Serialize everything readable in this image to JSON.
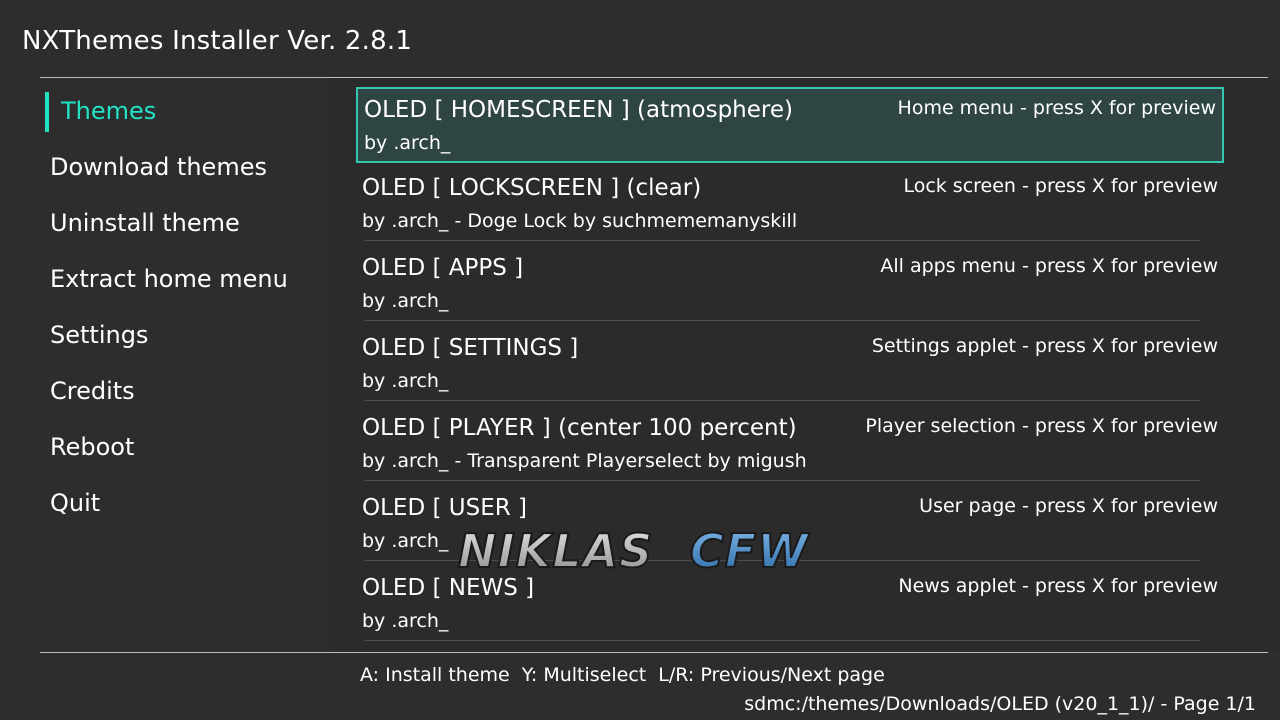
{
  "app": {
    "title": "NXThemes Installer Ver. 2.8.1"
  },
  "colors": {
    "accent": "#22e3c4",
    "background": "#2d2d2d",
    "selected_row": "#2f4543"
  },
  "sidebar": {
    "items": [
      {
        "label": "Themes",
        "active": true
      },
      {
        "label": "Download themes"
      },
      {
        "label": "Uninstall theme"
      },
      {
        "label": "Extract home menu"
      },
      {
        "label": "Settings"
      },
      {
        "label": "Credits"
      },
      {
        "label": "Reboot"
      },
      {
        "label": "Quit"
      }
    ]
  },
  "themes": [
    {
      "name": "OLED [ HOMESCREEN ] (atmosphere)",
      "author": "by .arch_",
      "target": "Home menu - press X for preview",
      "selected": true
    },
    {
      "name": "OLED [ LOCKSCREEN ] (clear)",
      "author": "by .arch_ - Doge Lock by suchmememanyskill",
      "target": "Lock screen - press X for preview"
    },
    {
      "name": "OLED [ APPS ]",
      "author": "by .arch_",
      "target": "All apps menu - press X for preview"
    },
    {
      "name": "OLED [ SETTINGS ]",
      "author": "by .arch_",
      "target": "Settings applet - press X for preview"
    },
    {
      "name": "OLED [ PLAYER ] (center 100 percent)",
      "author": "by .arch_ - Transparent Playerselect by migush",
      "target": "Player selection - press X for preview"
    },
    {
      "name": "OLED [ USER ]",
      "author": "by .arch_",
      "target": "User page - press X for preview"
    },
    {
      "name": "OLED [ NEWS ]",
      "author": "by .arch_",
      "target": "News applet - press X for preview"
    }
  ],
  "footer": {
    "controls": "A: Install theme  Y: Multiselect  L/R: Previous/Next page",
    "path": "sdmc:/themes/Downloads/OLED (v20_1_1)/ - Page 1/1"
  },
  "watermark": {
    "text": "NIKLASCFW"
  }
}
